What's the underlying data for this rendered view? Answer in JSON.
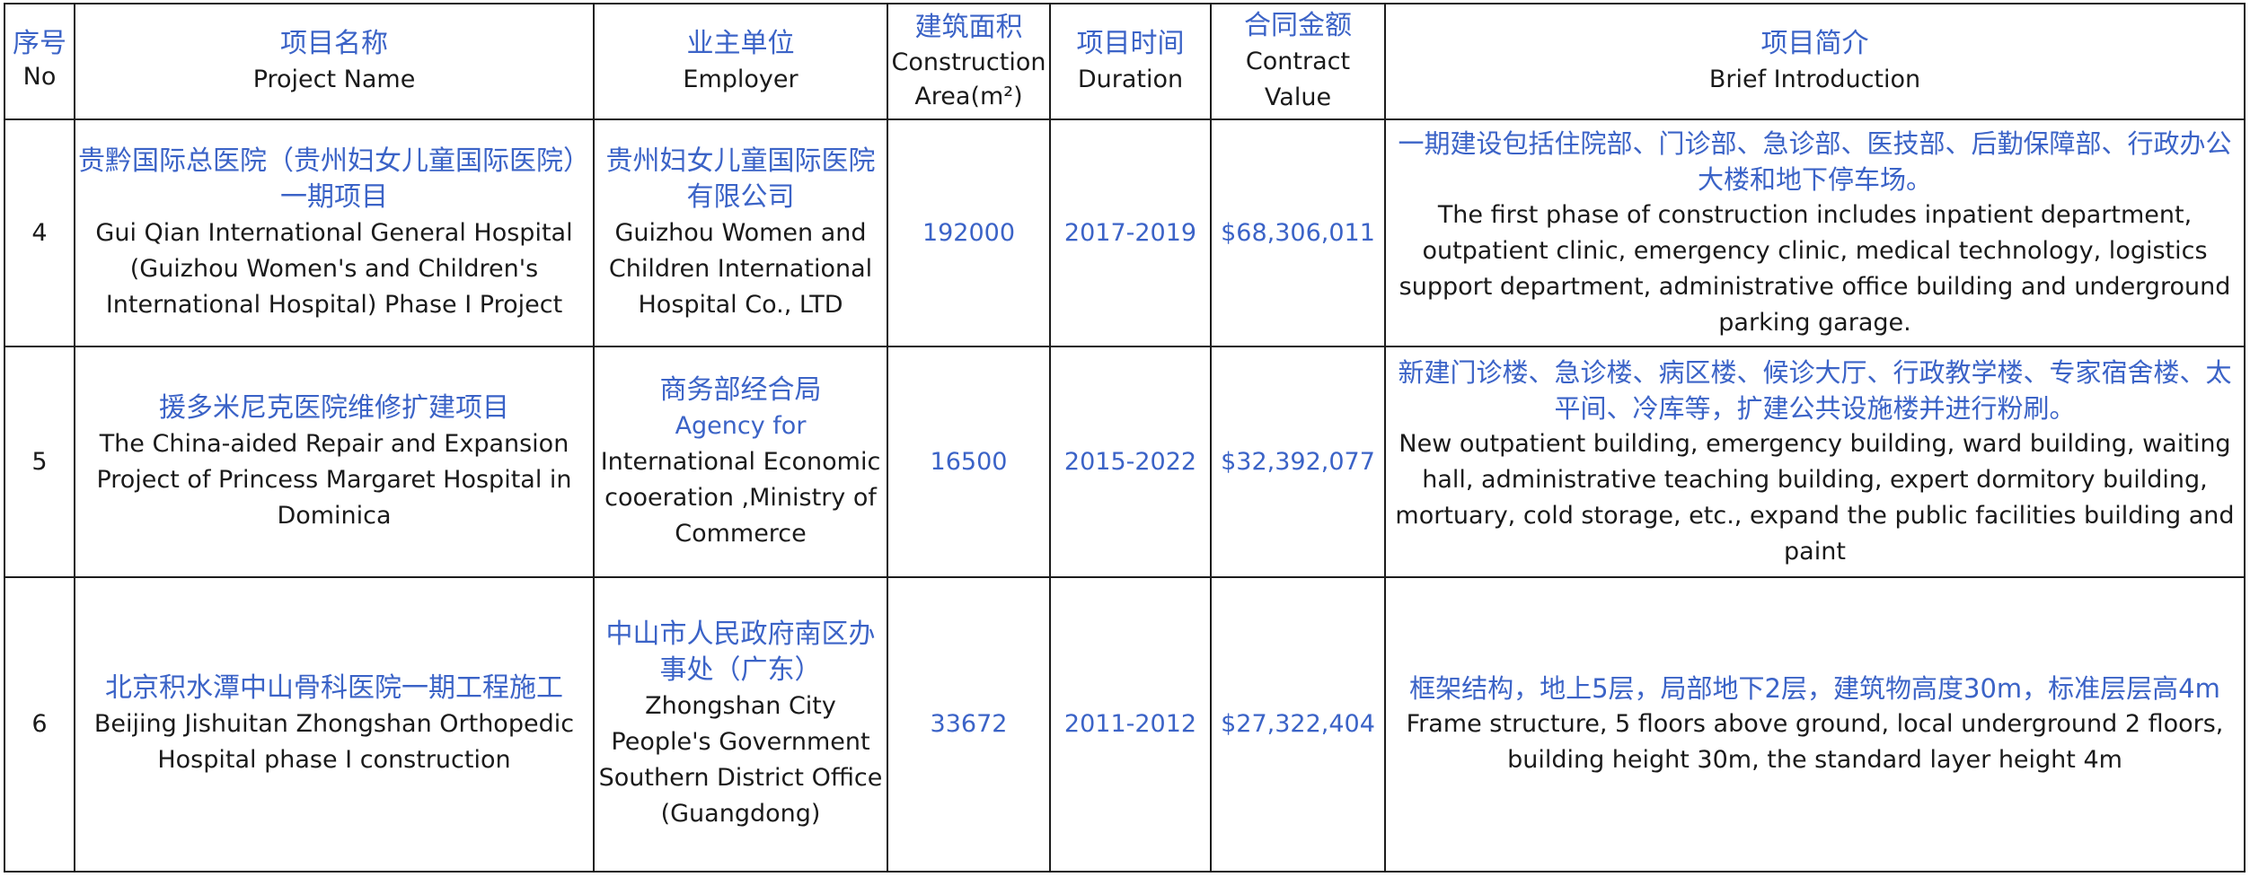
{
  "header": {
    "no": {
      "zh": "序号",
      "en": "No"
    },
    "project_name": {
      "zh": "项目名称",
      "en": "Project Name"
    },
    "employer": {
      "zh": "业主单位",
      "en": "Employer"
    },
    "area": {
      "zh": "建筑面积",
      "en": "Construction Area(m²)"
    },
    "duration": {
      "zh": "项目时间",
      "en": "Duration"
    },
    "value": {
      "zh": "合同金额",
      "en": "Contract Value"
    },
    "intro": {
      "zh": "项目简介",
      "en": "Brief Introduction"
    }
  },
  "rows": [
    {
      "no": "4",
      "project_zh": "贵黔国际总医院（贵州妇女儿童国际医院）一期项目",
      "project_en": "Gui Qian International General Hospital (Guizhou Women's and Children's International Hospital) Phase I Project",
      "employer_zh": "贵州妇女儿童国际医院有限公司",
      "employer_en": "Guizhou Women and Children International Hospital Co., LTD",
      "area": "192000",
      "duration": "2017-2019",
      "value": "$68,306,011",
      "intro_zh": "一期建设包括住院部、门诊部、急诊部、医技部、后勤保障部、行政办公大楼和地下停车场。",
      "intro_en": "The first phase of construction includes inpatient department, outpatient clinic, emergency clinic, medical technology, logistics support department, administrative office building and underground parking garage."
    },
    {
      "no": "5",
      "project_zh": "援多米尼克医院维修扩建项目",
      "project_en": "The China-aided Repair and Expansion Project of Princess Margaret Hospital in Dominica",
      "employer_zh": "商务部经合局",
      "employer_en_blue": "Agency for",
      "employer_en": "International Economic cooeration ,Ministry of Commerce",
      "area": "16500",
      "duration": "2015-2022",
      "value": "$32,392,077",
      "intro_zh": "新建门诊楼、急诊楼、病区楼、候诊大厅、行政教学楼、专家宿舍楼、太平间、冷库等，扩建公共设施楼并进行粉刷。",
      "intro_en": "New outpatient building, emergency building, ward building, waiting hall, administrative teaching building, expert dormitory building, mortuary, cold storage, etc., expand the public facilities building and paint"
    },
    {
      "no": "6",
      "project_zh": "北京积水潭中山骨科医院一期工程施工",
      "project_en": "Beijing Jishuitan Zhongshan Orthopedic Hospital phase I construction",
      "employer_zh": "中山市人民政府南区办事处（广东）",
      "employer_en": "Zhongshan City People's Government Southern District Office (Guangdong)",
      "area": "33672",
      "duration": "2011-2012",
      "value": "$27,322,404",
      "intro_zh": "框架结构，地上5层，局部地下2层，建筑物高度30m，标准层层高4m",
      "intro_en": "Frame structure, 5 floors above ground, local underground 2 floors, building height 30m, the standard layer height 4m"
    }
  ]
}
